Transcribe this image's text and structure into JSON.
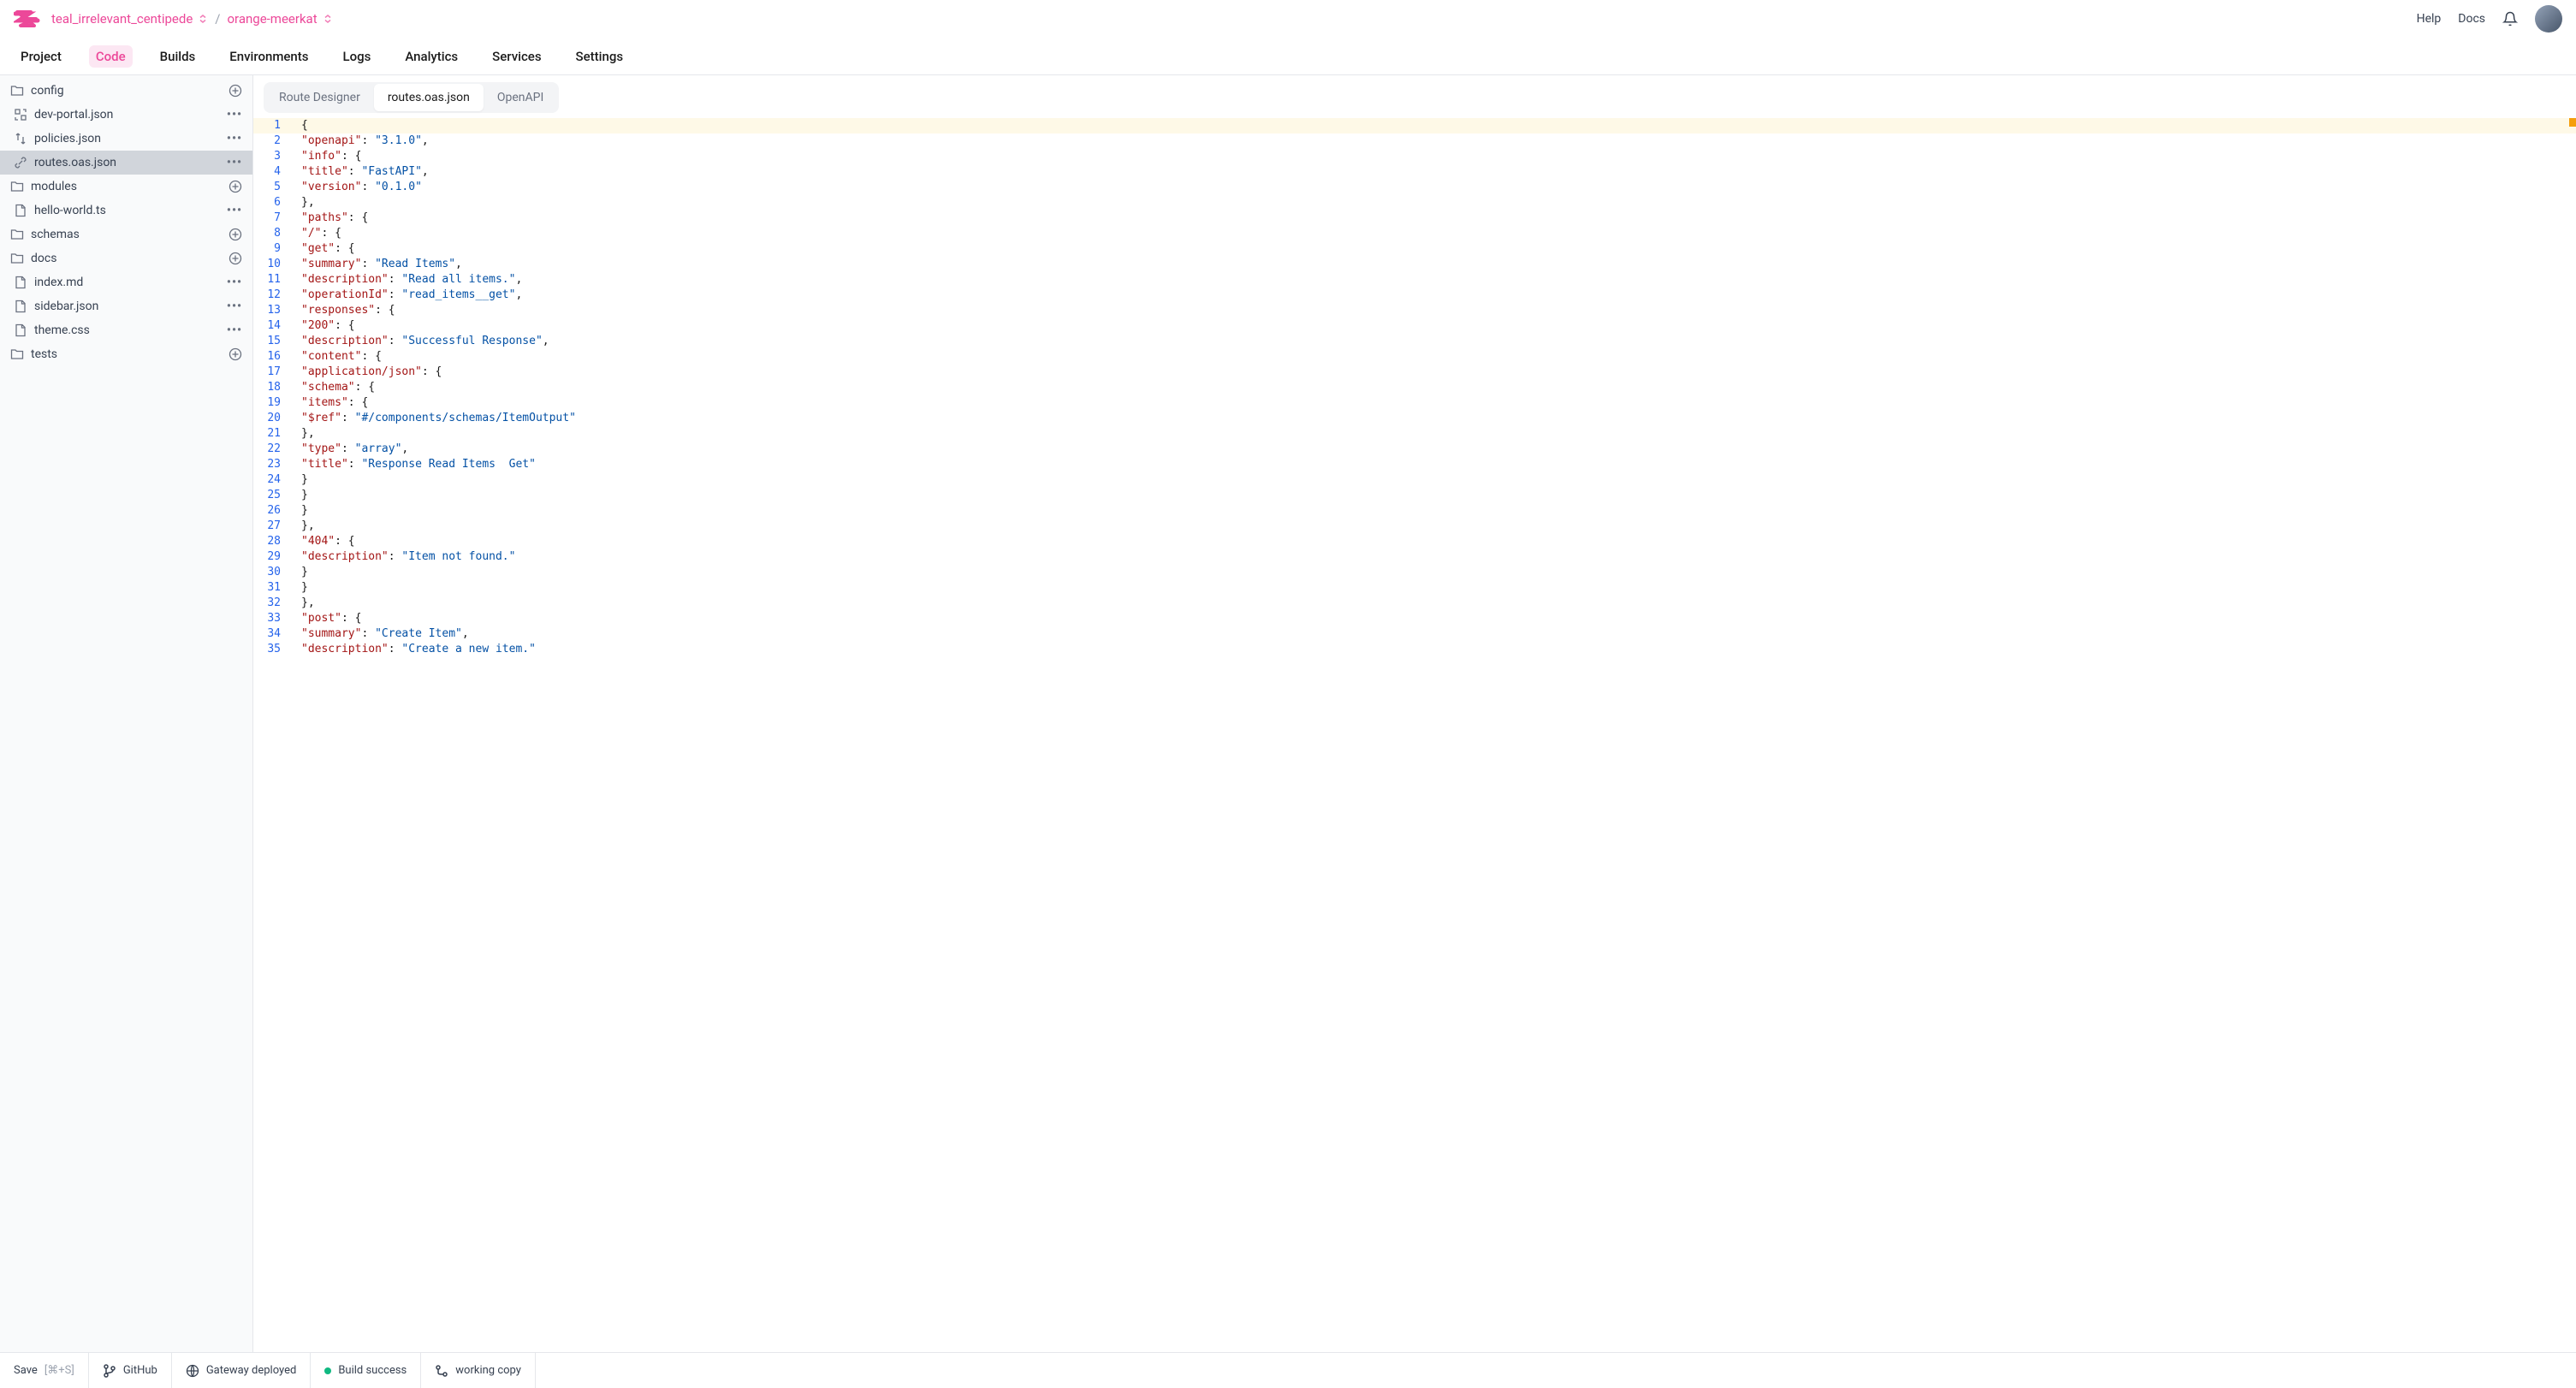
{
  "breadcrumb": {
    "project": "teal_irrelevant_centipede",
    "env": "orange-meerkat"
  },
  "topLinks": {
    "help": "Help",
    "docs": "Docs"
  },
  "navTabs": [
    "Project",
    "Code",
    "Builds",
    "Environments",
    "Logs",
    "Analytics",
    "Services",
    "Settings"
  ],
  "navActive": 1,
  "fileTree": [
    {
      "type": "folder",
      "name": "config",
      "action": "plus"
    },
    {
      "type": "file",
      "name": "dev-portal.json",
      "icon": "swap",
      "action": "dots",
      "child": true
    },
    {
      "type": "file",
      "name": "policies.json",
      "icon": "arrows",
      "action": "dots",
      "child": true
    },
    {
      "type": "file",
      "name": "routes.oas.json",
      "icon": "link",
      "action": "dots",
      "child": true,
      "selected": true
    },
    {
      "type": "folder",
      "name": "modules",
      "action": "plus"
    },
    {
      "type": "file",
      "name": "hello-world.ts",
      "icon": "file",
      "action": "dots",
      "child": true
    },
    {
      "type": "folder",
      "name": "schemas",
      "action": "plus"
    },
    {
      "type": "folder",
      "name": "docs",
      "action": "plus"
    },
    {
      "type": "file",
      "name": "index.md",
      "icon": "file",
      "action": "dots",
      "child": true
    },
    {
      "type": "file",
      "name": "sidebar.json",
      "icon": "file",
      "action": "dots",
      "child": true
    },
    {
      "type": "file",
      "name": "theme.css",
      "icon": "file",
      "action": "dots",
      "child": true
    },
    {
      "type": "folder",
      "name": "tests",
      "action": "plus"
    }
  ],
  "editorTabs": {
    "t0": "Route Designer",
    "t1": "routes.oas.json",
    "t2": "OpenAPI",
    "active": 1
  },
  "code": [
    [
      [
        "punc",
        "{"
      ]
    ],
    [
      [
        "key",
        "\"openapi\""
      ],
      [
        "punc",
        ": "
      ],
      [
        "str",
        "\"3.1.0\""
      ],
      [
        "punc",
        ","
      ]
    ],
    [
      [
        "key",
        "\"info\""
      ],
      [
        "punc",
        ": {"
      ]
    ],
    [
      [
        "key",
        "\"title\""
      ],
      [
        "punc",
        ": "
      ],
      [
        "str",
        "\"FastAPI\""
      ],
      [
        "punc",
        ","
      ]
    ],
    [
      [
        "key",
        "\"version\""
      ],
      [
        "punc",
        ": "
      ],
      [
        "str",
        "\"0.1.0\""
      ]
    ],
    [
      [
        "punc",
        "},"
      ]
    ],
    [
      [
        "key",
        "\"paths\""
      ],
      [
        "punc",
        ": {"
      ]
    ],
    [
      [
        "key",
        "\"/\""
      ],
      [
        "punc",
        ": {"
      ]
    ],
    [
      [
        "key",
        "\"get\""
      ],
      [
        "punc",
        ": {"
      ]
    ],
    [
      [
        "key",
        "\"summary\""
      ],
      [
        "punc",
        ": "
      ],
      [
        "str",
        "\"Read Items\""
      ],
      [
        "punc",
        ","
      ]
    ],
    [
      [
        "key",
        "\"description\""
      ],
      [
        "punc",
        ": "
      ],
      [
        "str",
        "\"Read all items.\""
      ],
      [
        "punc",
        ","
      ]
    ],
    [
      [
        "key",
        "\"operationId\""
      ],
      [
        "punc",
        ": "
      ],
      [
        "str",
        "\"read_items__get\""
      ],
      [
        "punc",
        ","
      ]
    ],
    [
      [
        "key",
        "\"responses\""
      ],
      [
        "punc",
        ": {"
      ]
    ],
    [
      [
        "key",
        "\"200\""
      ],
      [
        "punc",
        ": {"
      ]
    ],
    [
      [
        "key",
        "\"description\""
      ],
      [
        "punc",
        ": "
      ],
      [
        "str",
        "\"Successful Response\""
      ],
      [
        "punc",
        ","
      ]
    ],
    [
      [
        "key",
        "\"content\""
      ],
      [
        "punc",
        ": {"
      ]
    ],
    [
      [
        "key",
        "\"application/json\""
      ],
      [
        "punc",
        ": {"
      ]
    ],
    [
      [
        "key",
        "\"schema\""
      ],
      [
        "punc",
        ": {"
      ]
    ],
    [
      [
        "key",
        "\"items\""
      ],
      [
        "punc",
        ": {"
      ]
    ],
    [
      [
        "key",
        "\"$ref\""
      ],
      [
        "punc",
        ": "
      ],
      [
        "str",
        "\"#/components/schemas/ItemOutput\""
      ]
    ],
    [
      [
        "punc",
        "},"
      ]
    ],
    [
      [
        "key",
        "\"type\""
      ],
      [
        "punc",
        ": "
      ],
      [
        "str",
        "\"array\""
      ],
      [
        "punc",
        ","
      ]
    ],
    [
      [
        "key",
        "\"title\""
      ],
      [
        "punc",
        ": "
      ],
      [
        "str",
        "\"Response Read Items  Get\""
      ]
    ],
    [
      [
        "punc",
        "}"
      ]
    ],
    [
      [
        "punc",
        "}"
      ]
    ],
    [
      [
        "punc",
        "}"
      ]
    ],
    [
      [
        "punc",
        "},"
      ]
    ],
    [
      [
        "key",
        "\"404\""
      ],
      [
        "punc",
        ": {"
      ]
    ],
    [
      [
        "key",
        "\"description\""
      ],
      [
        "punc",
        ": "
      ],
      [
        "str",
        "\"Item not found.\""
      ]
    ],
    [
      [
        "punc",
        "}"
      ]
    ],
    [
      [
        "punc",
        "}"
      ]
    ],
    [
      [
        "punc",
        "},"
      ]
    ],
    [
      [
        "key",
        "\"post\""
      ],
      [
        "punc",
        ": {"
      ]
    ],
    [
      [
        "key",
        "\"summary\""
      ],
      [
        "punc",
        ": "
      ],
      [
        "str",
        "\"Create Item\""
      ],
      [
        "punc",
        ","
      ]
    ],
    [
      [
        "key",
        "\"description\""
      ],
      [
        "punc",
        ": "
      ],
      [
        "str",
        "\"Create a new item.\""
      ]
    ]
  ],
  "status": {
    "save": "Save",
    "saveKbd": "[⌘+S]",
    "github": "GitHub",
    "gateway": "Gateway deployed",
    "build": "Build success",
    "working": "working copy"
  }
}
